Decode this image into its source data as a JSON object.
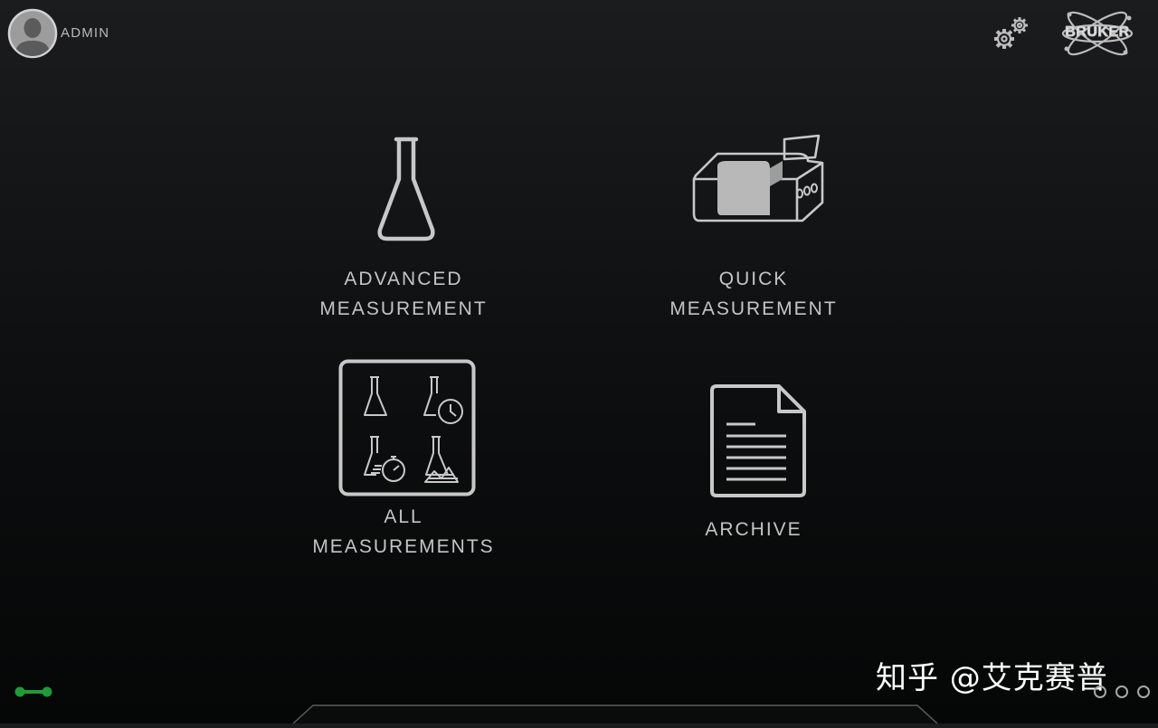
{
  "header": {
    "user_label": "ADMIN",
    "brand": "BRUKER",
    "icons": {
      "user": "user-avatar-icon",
      "settings": "gears-icon",
      "brand": "bruker-logo-icon"
    }
  },
  "tiles": [
    {
      "line1": "ADVANCED",
      "line2": "MEASUREMENT",
      "icon": "flask-icon"
    },
    {
      "line1": "QUICK",
      "line2": "MEASUREMENT",
      "icon": "spectrometer-icon"
    },
    {
      "line1": "ALL",
      "line2": "MEASUREMENTS",
      "icon": "measurements-grid-icon"
    },
    {
      "line1": "",
      "line2": "ARCHIVE",
      "icon": "document-icon"
    }
  ],
  "status": {
    "connection_icon": "connection-status-icon",
    "connection_color": "#1e9a3a"
  },
  "watermark": "知乎 @艾克赛普",
  "colors": {
    "icon_stroke": "#c8c8c8",
    "background": "#101112"
  }
}
